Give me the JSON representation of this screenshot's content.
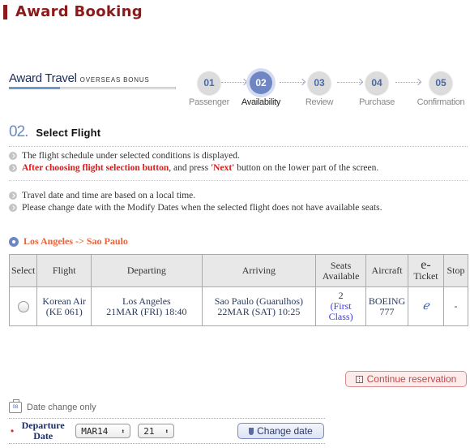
{
  "header": {
    "title": "Award Booking"
  },
  "award_travel": {
    "title": "Award Travel",
    "subtitle": "OVERSEAS BONUS"
  },
  "steps": [
    {
      "num": "01",
      "label": "Passenger",
      "active": false
    },
    {
      "num": "02",
      "label": "Availability",
      "active": true
    },
    {
      "num": "03",
      "label": "Review",
      "active": false
    },
    {
      "num": "04",
      "label": "Purchase",
      "active": false
    },
    {
      "num": "05",
      "label": "Confirmation",
      "active": false
    }
  ],
  "section": {
    "num": "02.",
    "title": "Select  Flight"
  },
  "notes_top": {
    "line1": "The flight schedule under selected conditions is displayed.",
    "line2_red": "After choosing flight selection button",
    "line2_mid": ", and press ",
    "line2_next": "'Next'",
    "line2_end": " button on the lower part of the screen."
  },
  "notes_bottom": {
    "line1": "Travel date and time are based on a local time.",
    "line2": "Please change date with the Modify Dates when the selected flight does not have available seats."
  },
  "route": "Los Angeles -> Sao Paulo",
  "table": {
    "headers": {
      "select": "Select",
      "flight": "Flight",
      "departing": "Departing",
      "arriving": "Arriving",
      "seats_1": "Seats",
      "seats_2": "Available",
      "aircraft": "Aircraft",
      "eticket_1": "e-",
      "eticket_2": "Ticket",
      "stop": "Stop"
    },
    "rows": [
      {
        "airline": "Korean Air",
        "flight_no": "(KE 061)",
        "dep_city": "Los Angeles",
        "dep_time": "21MAR (FRI) 18:40",
        "arr_city": "Sao Paulo (Guarulhos)",
        "arr_time": "22MAR (SAT) 10:25",
        "seats": "2",
        "seat_class_1": "(First",
        "seat_class_2": "Class)",
        "aircraft_1": "BOEING",
        "aircraft_2": "777",
        "eticket": "ℯ",
        "stop": "-"
      }
    ]
  },
  "continue_button": "Continue reservation",
  "date_change": {
    "label": "Date change only",
    "icon_text": "08",
    "required_mark": "•",
    "field_label_1": "Departure",
    "field_label_2": "Date",
    "month_value": "MAR14",
    "day_value": "21",
    "select_arrow": "⬍",
    "change_button": "Change date"
  }
}
